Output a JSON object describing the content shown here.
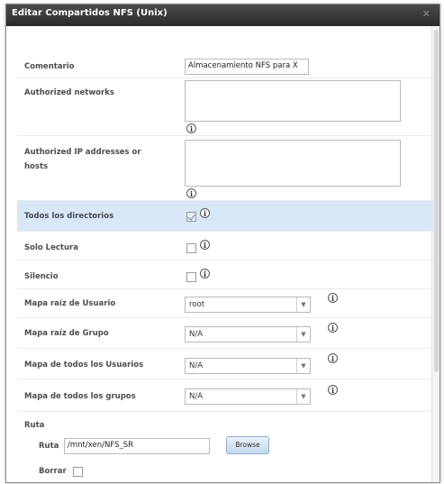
{
  "dialog": {
    "title": "Editar Compartidos NFS (Unix)"
  },
  "form": {
    "comment": {
      "label": "Comentario",
      "value": "Almacenamiento NFS para X"
    },
    "authorized_networks": {
      "label": "Authorized networks",
      "value": ""
    },
    "authorized_ip": {
      "label": "Authorized IP addresses or hosts",
      "value": ""
    },
    "all_dirs": {
      "label": "Todos los directorios",
      "checked": true
    },
    "read_only": {
      "label": "Solo Lectura",
      "checked": false
    },
    "quiet": {
      "label": "Silencio",
      "checked": false
    },
    "maproot_user": {
      "label": "Mapa raíz de Usuario",
      "value": "root"
    },
    "maproot_group": {
      "label": "Mapa raíz de Grupo",
      "value": "N/A"
    },
    "mapall_user": {
      "label": "Mapa de todos los Usuarios",
      "value": "N/A"
    },
    "mapall_group": {
      "label": "Mapa de todos los grupos",
      "value": "N/A"
    }
  },
  "path_section": {
    "legend": "Ruta",
    "path_label": "Ruta",
    "path_value": "/mnt/xen/NFS_SR",
    "browse_label": "Browse",
    "delete_label": "Borrar",
    "delete_checked": false
  },
  "icons": {
    "help": "info-icon",
    "dropdown": "chevron-down-icon"
  },
  "colors": {
    "titlebar": "#333333",
    "highlight_row": "#d7e7f6"
  }
}
